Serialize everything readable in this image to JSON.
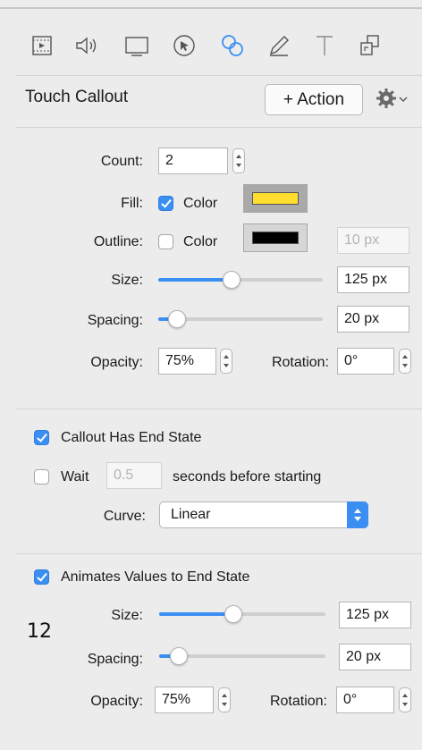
{
  "toolbar": {
    "icons": [
      "film-icon",
      "speaker-icon",
      "display-icon",
      "cursor-icon",
      "touch-callout-icon",
      "pencil-icon",
      "text-icon",
      "export-icon"
    ],
    "active_icon": "touch-callout-icon"
  },
  "header": {
    "title": "Touch Callout",
    "action_label": "+ Action",
    "gear_icon": "gear-icon"
  },
  "callout": {
    "count_label": "Count:",
    "count_value": "2",
    "fill_label": "Fill:",
    "fill_checked": true,
    "fill_color_label": "Color",
    "fill_color": "#ffde2e",
    "outline_label": "Outline:",
    "outline_checked": false,
    "outline_color_label": "Color",
    "outline_color": "#000000",
    "outline_width": "10 px",
    "size_label": "Size:",
    "size_value": "125 px",
    "size_slider_fraction": 0.44,
    "spacing_label": "Spacing:",
    "spacing_value": "20 px",
    "spacing_slider_fraction": 0.07,
    "opacity_label": "Opacity:",
    "opacity_value": "75%",
    "rotation_label": "Rotation:",
    "rotation_value": "0°"
  },
  "end_state": {
    "has_end_state_label": "Callout Has End State",
    "has_end_state_checked": true,
    "wait_label": "Wait",
    "wait_checked": false,
    "wait_value": "0.5",
    "wait_suffix": "seconds before starting",
    "curve_label": "Curve:",
    "curve_value": "Linear"
  },
  "animate": {
    "animates_label": "Animates Values to End State",
    "animates_checked": true,
    "size_label": "Size:",
    "size_value": "125 px",
    "size_slider_fraction": 0.44,
    "spacing_label": "Spacing:",
    "spacing_value": "20 px",
    "spacing_slider_fraction": 0.07,
    "opacity_label": "Opacity:",
    "opacity_value": "75%",
    "rotation_label": "Rotation:",
    "rotation_value": "0°"
  },
  "annotation": "12",
  "colors": {
    "accent": "#3b8ff3",
    "background": "#ececec"
  }
}
